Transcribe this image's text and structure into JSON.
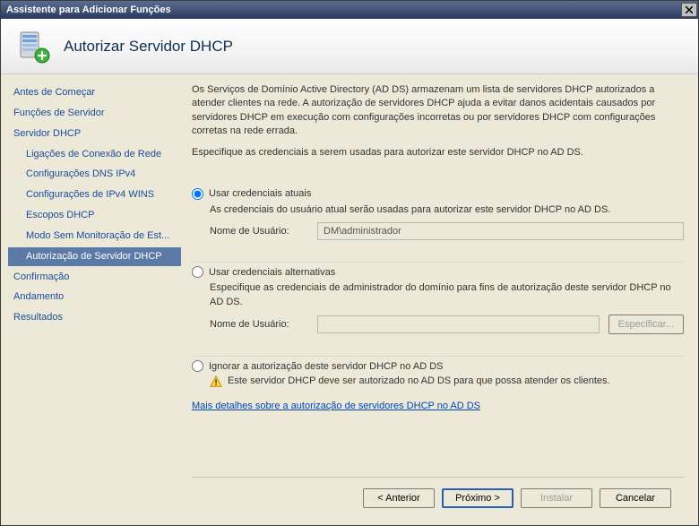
{
  "window": {
    "title": "Assistente para Adicionar Funções"
  },
  "header": {
    "title": "Autorizar Servidor DHCP"
  },
  "sidebar": {
    "items": [
      {
        "label": "Antes de Começar"
      },
      {
        "label": "Funções de Servidor"
      },
      {
        "label": "Servidor DHCP"
      },
      {
        "label": "Ligações de Conexão de Rede"
      },
      {
        "label": "Configurações DNS IPv4"
      },
      {
        "label": "Configurações de IPv4 WINS"
      },
      {
        "label": "Escopos DHCP"
      },
      {
        "label": "Modo Sem Monitoração de Est..."
      },
      {
        "label": "Autorização de Servidor DHCP"
      },
      {
        "label": "Confirmação"
      },
      {
        "label": "Andamento"
      },
      {
        "label": "Resultados"
      }
    ]
  },
  "content": {
    "intro1": "Os Serviços de Domínio Active Directory (AD DS) armazenam um lista de servidores DHCP autorizados a atender clientes na rede. A autorização de servidores DHCP ajuda a evitar danos acidentais causados por servidores DHCP em execução com configurações incorretas ou por servidores DHCP com configurações corretas na rede errada.",
    "intro2": "Especifique as credenciais a serem usadas para autorizar este servidor DHCP no AD DS.",
    "opt1": {
      "label": "Usar credenciais atuais",
      "desc": "As credenciais do usuário atual serão usadas para autorizar este servidor DHCP no AD DS.",
      "username_label": "Nome de Usuário:",
      "username_value": "DM\\administrador"
    },
    "opt2": {
      "label": "Usar credenciais alternativas",
      "desc": "Especifique as credenciais de administrador do domínio para fins de autorização deste servidor DHCP no AD DS.",
      "username_label": "Nome de Usuário:",
      "specify_btn": "Especificar..."
    },
    "opt3": {
      "label": "Ignorar a autorização deste servidor DHCP no AD DS",
      "warn": "Este servidor DHCP deve ser autorizado no AD DS para que possa atender os clientes."
    },
    "link": "Mais detalhes sobre a autorização de servidores DHCP no AD DS"
  },
  "footer": {
    "back": "< Anterior",
    "next": "Próximo >",
    "install": "Instalar",
    "cancel": "Cancelar"
  }
}
